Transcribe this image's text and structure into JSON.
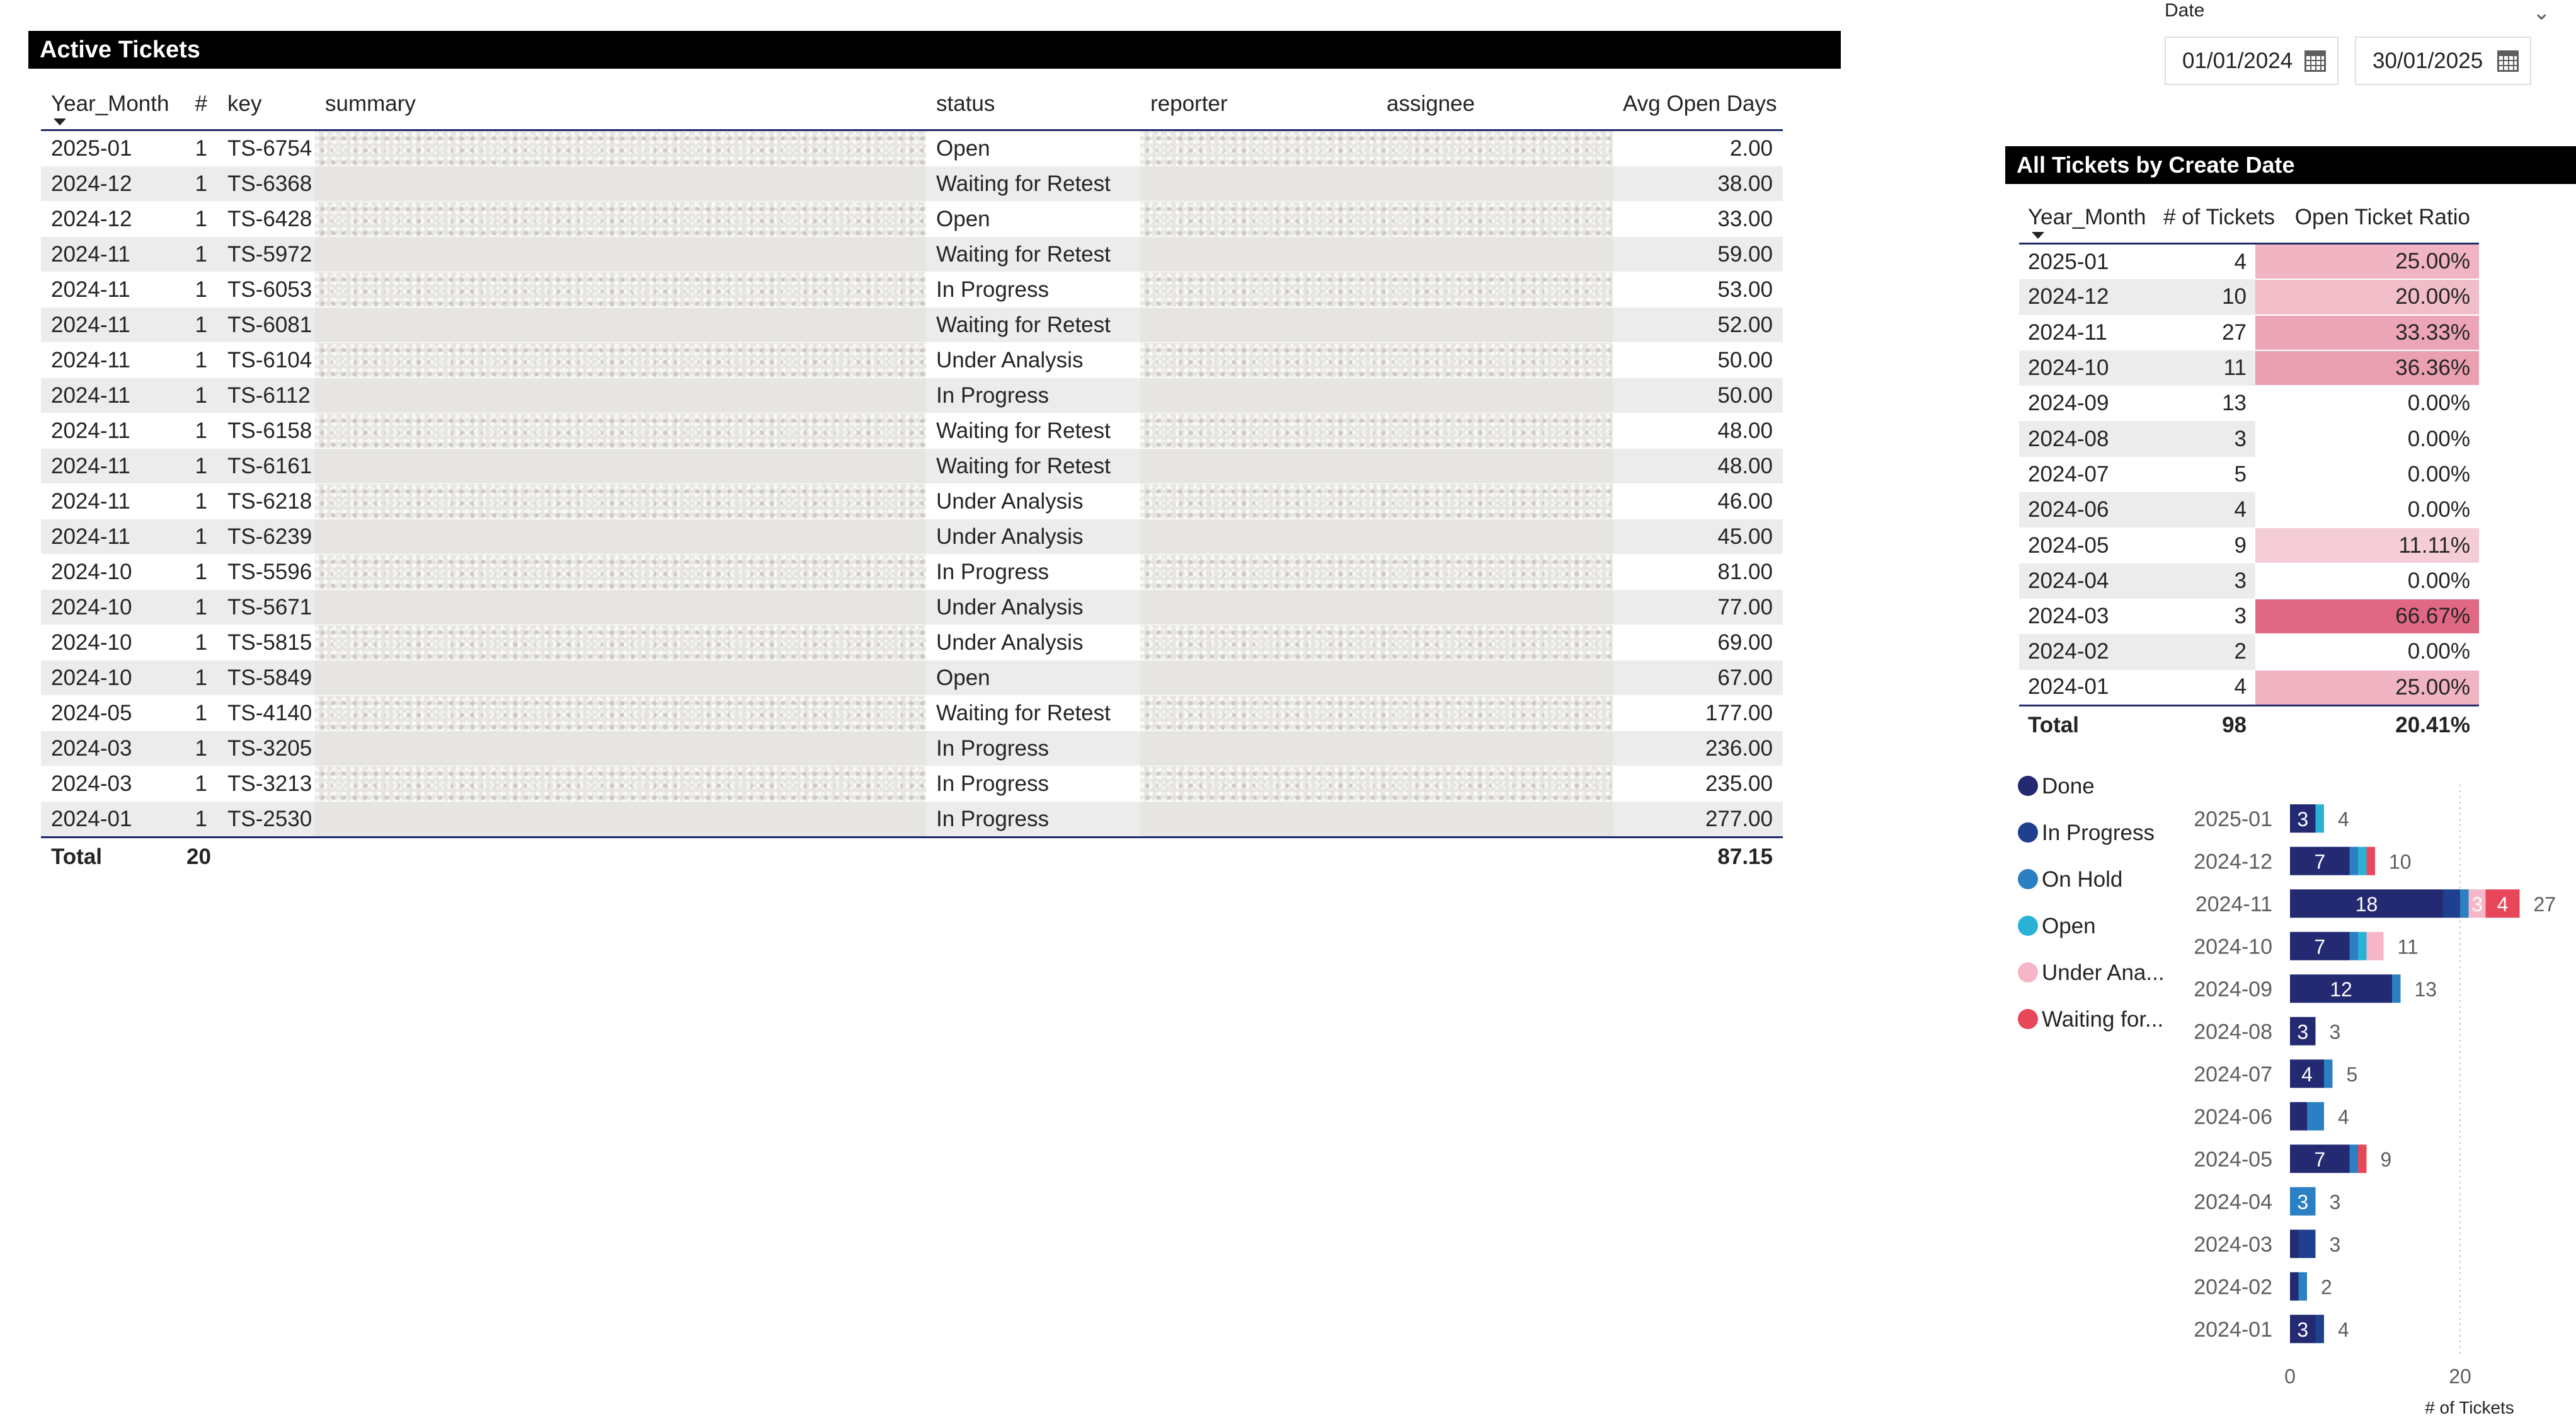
{
  "active_tickets": {
    "title": "Active Tickets",
    "columns": [
      "Year_Month",
      "#",
      "key",
      "summary",
      "status",
      "reporter",
      "assignee",
      "Avg Open Days"
    ],
    "rows": [
      {
        "year_month": "2025-01",
        "count": "1",
        "key": "TS-6754",
        "status": "Open",
        "avg_open_days": "2.00"
      },
      {
        "year_month": "2024-12",
        "count": "1",
        "key": "TS-6368",
        "status": "Waiting for Retest",
        "avg_open_days": "38.00"
      },
      {
        "year_month": "2024-12",
        "count": "1",
        "key": "TS-6428",
        "status": "Open",
        "avg_open_days": "33.00"
      },
      {
        "year_month": "2024-11",
        "count": "1",
        "key": "TS-5972",
        "status": "Waiting for Retest",
        "avg_open_days": "59.00"
      },
      {
        "year_month": "2024-11",
        "count": "1",
        "key": "TS-6053",
        "status": "In Progress",
        "avg_open_days": "53.00"
      },
      {
        "year_month": "2024-11",
        "count": "1",
        "key": "TS-6081",
        "status": "Waiting for Retest",
        "avg_open_days": "52.00"
      },
      {
        "year_month": "2024-11",
        "count": "1",
        "key": "TS-6104",
        "status": "Under Analysis",
        "avg_open_days": "50.00"
      },
      {
        "year_month": "2024-11",
        "count": "1",
        "key": "TS-6112",
        "status": "In Progress",
        "avg_open_days": "50.00"
      },
      {
        "year_month": "2024-11",
        "count": "1",
        "key": "TS-6158",
        "status": "Waiting for Retest",
        "avg_open_days": "48.00"
      },
      {
        "year_month": "2024-11",
        "count": "1",
        "key": "TS-6161",
        "status": "Waiting for Retest",
        "avg_open_days": "48.00"
      },
      {
        "year_month": "2024-11",
        "count": "1",
        "key": "TS-6218",
        "status": "Under Analysis",
        "avg_open_days": "46.00"
      },
      {
        "year_month": "2024-11",
        "count": "1",
        "key": "TS-6239",
        "status": "Under Analysis",
        "avg_open_days": "45.00"
      },
      {
        "year_month": "2024-10",
        "count": "1",
        "key": "TS-5596",
        "status": "In Progress",
        "avg_open_days": "81.00"
      },
      {
        "year_month": "2024-10",
        "count": "1",
        "key": "TS-5671",
        "status": "Under Analysis",
        "avg_open_days": "77.00"
      },
      {
        "year_month": "2024-10",
        "count": "1",
        "key": "TS-5815",
        "status": "Under Analysis",
        "avg_open_days": "69.00"
      },
      {
        "year_month": "2024-10",
        "count": "1",
        "key": "TS-5849",
        "status": "Open",
        "avg_open_days": "67.00"
      },
      {
        "year_month": "2024-05",
        "count": "1",
        "key": "TS-4140",
        "status": "Waiting for Retest",
        "avg_open_days": "177.00"
      },
      {
        "year_month": "2024-03",
        "count": "1",
        "key": "TS-3205",
        "status": "In Progress",
        "avg_open_days": "236.00"
      },
      {
        "year_month": "2024-03",
        "count": "1",
        "key": "TS-3213",
        "status": "In Progress",
        "avg_open_days": "235.00"
      },
      {
        "year_month": "2024-01",
        "count": "1",
        "key": "TS-2530",
        "status": "In Progress",
        "avg_open_days": "277.00"
      }
    ],
    "total": {
      "label": "Total",
      "count": "20",
      "avg_open_days": "87.15"
    }
  },
  "date_filter": {
    "label": "Date",
    "start": "01/01/2024",
    "end": "30/01/2025"
  },
  "all_tickets": {
    "title": "All Tickets by Create Date",
    "columns": [
      "Year_Month",
      "# of Tickets",
      "Open Ticket Ratio"
    ],
    "rows": [
      {
        "year_month": "2025-01",
        "tickets": "4",
        "ratio": "25.00%",
        "ratio_value": 0.25
      },
      {
        "year_month": "2024-12",
        "tickets": "10",
        "ratio": "20.00%",
        "ratio_value": 0.2
      },
      {
        "year_month": "2024-11",
        "tickets": "27",
        "ratio": "33.33%",
        "ratio_value": 0.3333
      },
      {
        "year_month": "2024-10",
        "tickets": "11",
        "ratio": "36.36%",
        "ratio_value": 0.3636
      },
      {
        "year_month": "2024-09",
        "tickets": "13",
        "ratio": "0.00%",
        "ratio_value": 0
      },
      {
        "year_month": "2024-08",
        "tickets": "3",
        "ratio": "0.00%",
        "ratio_value": 0
      },
      {
        "year_month": "2024-07",
        "tickets": "5",
        "ratio": "0.00%",
        "ratio_value": 0
      },
      {
        "year_month": "2024-06",
        "tickets": "4",
        "ratio": "0.00%",
        "ratio_value": 0
      },
      {
        "year_month": "2024-05",
        "tickets": "9",
        "ratio": "11.11%",
        "ratio_value": 0.1111
      },
      {
        "year_month": "2024-04",
        "tickets": "3",
        "ratio": "0.00%",
        "ratio_value": 0
      },
      {
        "year_month": "2024-03",
        "tickets": "3",
        "ratio": "66.67%",
        "ratio_value": 0.6667
      },
      {
        "year_month": "2024-02",
        "tickets": "2",
        "ratio": "0.00%",
        "ratio_value": 0
      },
      {
        "year_month": "2024-01",
        "tickets": "4",
        "ratio": "25.00%",
        "ratio_value": 0.25
      }
    ],
    "total": {
      "label": "Total",
      "tickets": "98",
      "ratio": "20.41%"
    }
  },
  "legend": [
    {
      "label": "Done",
      "color": "#232a72"
    },
    {
      "label": "In Progress",
      "color": "#1f3f8f"
    },
    {
      "label": "On Hold",
      "color": "#2b7fc3"
    },
    {
      "label": "Open",
      "color": "#2ab2d6"
    },
    {
      "label": "Under Ana...",
      "color": "#f7b6c8"
    },
    {
      "label": "Waiting for...",
      "color": "#e8475a"
    }
  ],
  "chart_data": {
    "type": "bar",
    "orientation": "horizontal",
    "stacked": true,
    "categories": [
      "2025-01",
      "2024-12",
      "2024-11",
      "2024-10",
      "2024-09",
      "2024-08",
      "2024-07",
      "2024-06",
      "2024-05",
      "2024-04",
      "2024-03",
      "2024-02",
      "2024-01"
    ],
    "series": [
      {
        "name": "Done",
        "color": "#232a72",
        "values": [
          3,
          7,
          18,
          7,
          12,
          3,
          4,
          2,
          7,
          0,
          1,
          1,
          3
        ]
      },
      {
        "name": "In Progress",
        "color": "#1f3f8f",
        "values": [
          0,
          0,
          2,
          0,
          0,
          0,
          0,
          0,
          0,
          0,
          2,
          0,
          1
        ]
      },
      {
        "name": "On Hold",
        "color": "#2b7fc3",
        "values": [
          0,
          1,
          1,
          1,
          1,
          0,
          1,
          2,
          1,
          3,
          0,
          1,
          0
        ]
      },
      {
        "name": "Open",
        "color": "#2ab2d6",
        "values": [
          1,
          1,
          0,
          1,
          0,
          0,
          0,
          0,
          0,
          0,
          0,
          0,
          0
        ]
      },
      {
        "name": "Under Ana...",
        "color": "#f7b6c8",
        "values": [
          0,
          0,
          2,
          2,
          0,
          0,
          0,
          0,
          0,
          0,
          0,
          0,
          0
        ]
      },
      {
        "name": "Waiting for...",
        "color": "#e8475a",
        "values": [
          0,
          1,
          4,
          0,
          0,
          0,
          0,
          0,
          1,
          0,
          0,
          0,
          0
        ]
      }
    ],
    "segment_labels": [
      {
        "category": "2025-01",
        "series": "Done",
        "text": "3"
      },
      {
        "category": "2024-12",
        "series": "Done",
        "text": "7"
      },
      {
        "category": "2024-11",
        "series": "Done",
        "text": "18"
      },
      {
        "category": "2024-11",
        "series": "Under Ana...",
        "text": "3"
      },
      {
        "category": "2024-11",
        "series": "Waiting for...",
        "text": "4"
      },
      {
        "category": "2024-10",
        "series": "Done",
        "text": "7"
      },
      {
        "category": "2024-09",
        "series": "Done",
        "text": "12"
      },
      {
        "category": "2024-08",
        "series": "Done",
        "text": "3"
      },
      {
        "category": "2024-07",
        "series": "Done",
        "text": "4"
      },
      {
        "category": "2024-05",
        "series": "Done",
        "text": "7"
      },
      {
        "category": "2024-04",
        "series": "On Hold",
        "text": "3"
      },
      {
        "category": "2024-01",
        "series": "Done",
        "text": "3"
      }
    ],
    "totals": [
      4,
      10,
      27,
      11,
      13,
      3,
      5,
      4,
      9,
      3,
      3,
      2,
      4
    ],
    "x_ticks": [
      "0",
      "20"
    ],
    "xlim": [
      0,
      20
    ],
    "xlabel": "# of Tickets",
    "grid": true
  }
}
